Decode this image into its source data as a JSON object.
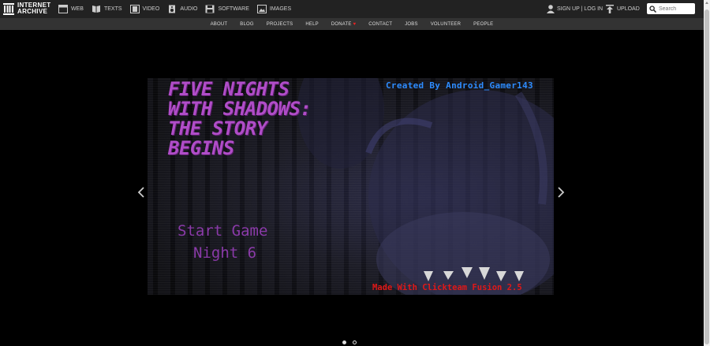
{
  "header": {
    "logo_line1": "INTERNET",
    "logo_line2": "ARCHIVE",
    "media_nav": [
      {
        "label": "WEB",
        "icon": "web-icon"
      },
      {
        "label": "TEXTS",
        "icon": "book-icon"
      },
      {
        "label": "VIDEO",
        "icon": "film-icon"
      },
      {
        "label": "AUDIO",
        "icon": "speaker-icon"
      },
      {
        "label": "SOFTWARE",
        "icon": "floppy-icon"
      },
      {
        "label": "IMAGES",
        "icon": "image-icon"
      }
    ],
    "signup_login": "SIGN UP | LOG IN",
    "upload": "UPLOAD",
    "search_placeholder": "Search"
  },
  "subnav": {
    "items": [
      "ABOUT",
      "BLOG",
      "PROJECTS",
      "HELP",
      "DONATE",
      "CONTACT",
      "JOBS",
      "VOLUNTEER",
      "PEOPLE"
    ]
  },
  "game": {
    "title": "FIVE NIGHTS WITH SHADOWS: THE STORY BEGINS",
    "created_by": "Created By Android_Gamer143",
    "menu_options": [
      "Start Game",
      "Night 6"
    ],
    "made_with": "Made With Clickteam Fusion 2.5"
  },
  "carousel": {
    "current_slide": 1,
    "total_slides": 2
  },
  "colors": {
    "topbar": "#222222",
    "subnav": "#333333",
    "title_purple": "#b04dc8",
    "credit_blue": "#2d8cff",
    "credit_red": "#e01818"
  }
}
